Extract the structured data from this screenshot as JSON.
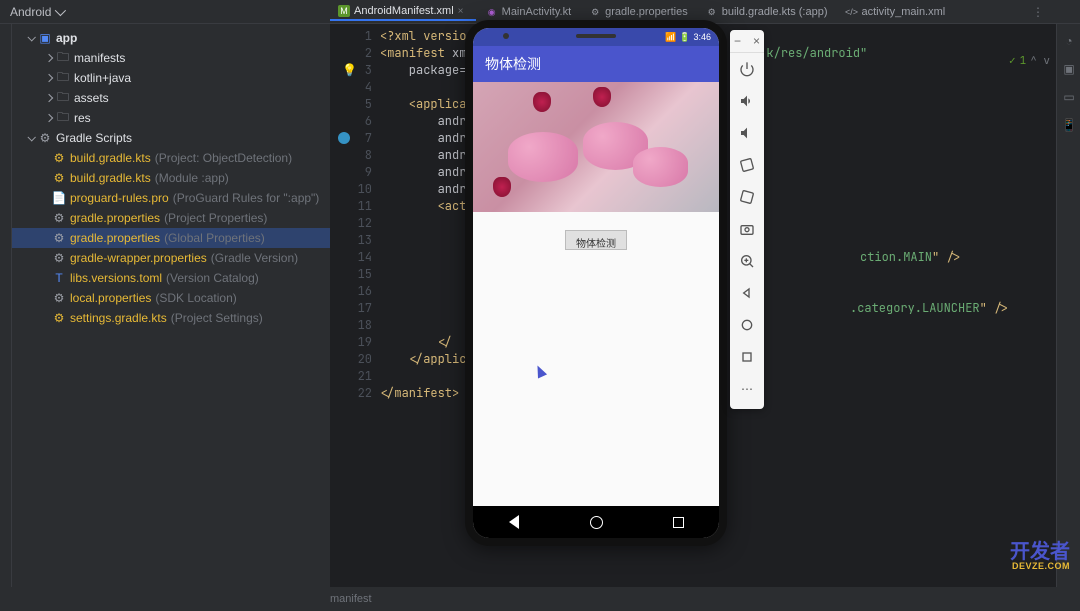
{
  "topbar": {
    "project_view": "Android"
  },
  "tabs": [
    {
      "icon": "M",
      "icon_color": "#5c962c",
      "label": "AndroidManifest.xml",
      "active": true
    },
    {
      "icon": "K",
      "icon_color": "#af5fd6",
      "label": "MainActivity.kt",
      "active": false
    },
    {
      "icon": "⚙",
      "icon_color": "#9da0a8",
      "label": "gradle.properties",
      "active": false
    },
    {
      "icon": "⚙",
      "icon_color": "#9da0a8",
      "label": "build.gradle.kts (:app)",
      "active": false
    },
    {
      "icon": "</>",
      "icon_color": "#9da0a8",
      "label": "activity_main.xml",
      "active": false
    }
  ],
  "tree": {
    "app": "app",
    "manifests": "manifests",
    "kotlin_java": "kotlin+java",
    "assets": "assets",
    "res": "res",
    "gradle_scripts": "Gradle Scripts",
    "items": [
      {
        "name": "build.gradle.kts",
        "hint": "(Project: ObjectDetection)"
      },
      {
        "name": "build.gradle.kts",
        "hint": "(Module :app)"
      },
      {
        "name": "proguard-rules.pro",
        "hint": "(ProGuard Rules for \":app\")"
      },
      {
        "name": "gradle.properties",
        "hint": "(Project Properties)"
      },
      {
        "name": "gradle.properties",
        "hint": "(Global Properties)"
      },
      {
        "name": "gradle-wrapper.properties",
        "hint": "(Gradle Version)"
      },
      {
        "name": "libs.versions.toml",
        "hint": "(Version Catalog)"
      },
      {
        "name": "local.properties",
        "hint": "(SDK Location)"
      },
      {
        "name": "settings.gradle.kts",
        "hint": "(Project Settings)"
      }
    ]
  },
  "gutter": [
    "1",
    "2",
    "3",
    "4",
    "5",
    "6",
    "7",
    "8",
    "9",
    "10",
    "11",
    "12",
    "13",
    "14",
    "15",
    "16",
    "17",
    "18",
    "19",
    "20",
    "21",
    "22"
  ],
  "code": {
    "l1_a": "<?xml versio",
    "l2_a": "<manifest ",
    "l2_b": "xm",
    "l2_end_a": "k/res/android",
    "l2_end_b": "\"",
    "l3_a": "    package=",
    "l5_a": "    <applica",
    "l6_a": "        andr",
    "l7_a": "        andr",
    "l8_a": "        andr",
    "l9_a": "        andr",
    "l10_a": "        andr",
    "l11_a": "        <act",
    "l14_end_a": "ction.MAIN",
    "l14_end_b": "\" />",
    "l17_end_a": ".category.LAUNCHER",
    "l17_end_b": "\" />",
    "l19_a": "        </",
    "l20_a": "    </applic",
    "l22_a": "</manifest>"
  },
  "validation": {
    "count": "1",
    "arrows": "^ v"
  },
  "emulator": {
    "status_time": "3:46",
    "app_title": "物体检测",
    "button_label": "物体检测"
  },
  "status": {
    "breadcrumb": "manifest"
  },
  "watermark": {
    "main": "开发者",
    "sub": "DEVZE.COM"
  }
}
